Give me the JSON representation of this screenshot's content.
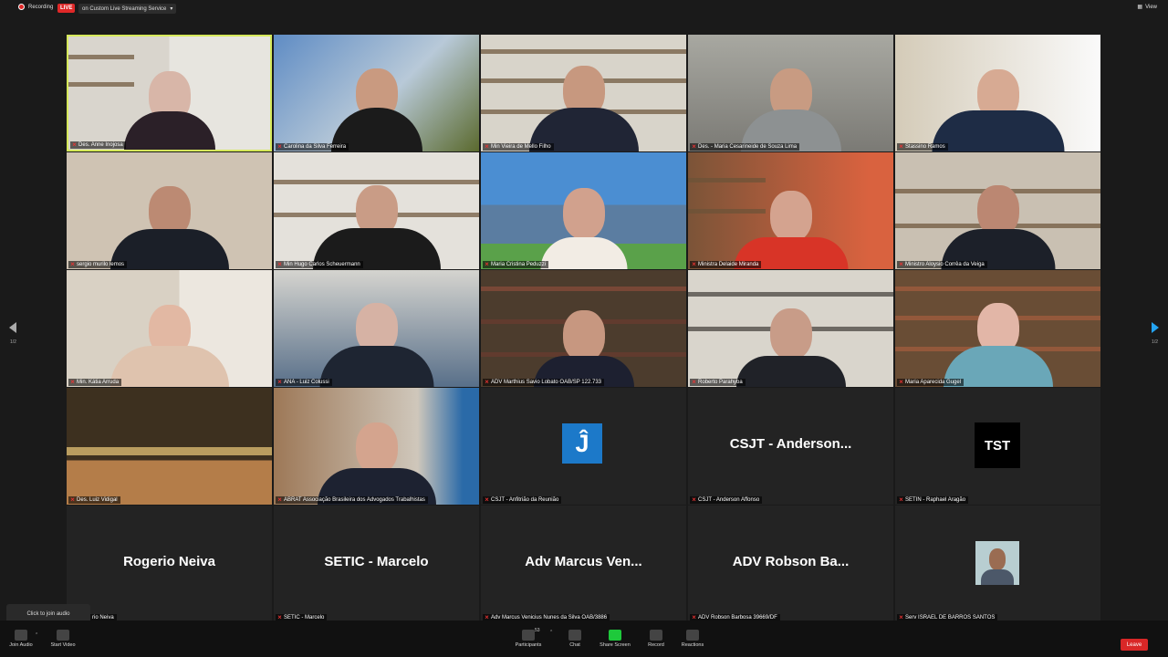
{
  "top": {
    "recording": "Recording",
    "live": "LIVE",
    "stream": "on Custom Live Streaming Service",
    "view": "View"
  },
  "pagination": {
    "left": "1/2",
    "right": "1/2"
  },
  "participants": [
    {
      "name": "Des. Anne Inojosa"
    },
    {
      "name": "Carolina da Silva Ferreira"
    },
    {
      "name": "Min Vieira de Mello Filho"
    },
    {
      "name": "Des. - Maria Cesarineide de Souza Lima"
    },
    {
      "name": "Stassino Ramos"
    },
    {
      "name": "sergio murilo lemos"
    },
    {
      "name": "Min Hugo Carlos Scheuermann"
    },
    {
      "name": "Maria Cristina Peduzzi"
    },
    {
      "name": "Ministra Delaide Miranda"
    },
    {
      "name": "Ministro Aloysio Corrêa da Veiga"
    },
    {
      "name": "Min. Kátia Arruda"
    },
    {
      "name": "ANA - Luiz Colussi"
    },
    {
      "name": "ADV Marthius Savio Lobato OAB/SP 122.733"
    },
    {
      "name": "Roberto Parahyba"
    },
    {
      "name": "Maria Aparecida Gugel"
    },
    {
      "name": "Des. Luiz Vidigal"
    },
    {
      "name": "ABRAT Associação Brasileira dos Advogados Trabalhistas"
    },
    {
      "name": "CSJT - Anfitrião da Reunião"
    },
    {
      "name": "CSJT - Anderson Affonso",
      "display": "CSJT  - Anderson..."
    },
    {
      "name": "SETIN - Raphael Aragão"
    },
    {
      "name": "rio Neiva",
      "display": "Rogerio Neiva"
    },
    {
      "name": "SETIC - Marcelo",
      "display": "SETIC - Marcelo"
    },
    {
      "name": "Adv Marcus Venicius Nunes da Silva OAB/3886",
      "display": "Adv Marcus Ven..."
    },
    {
      "name": "ADV Robson Barbosa 39669/DF",
      "display": "ADV Robson Ba..."
    },
    {
      "name": "Serv ISRAEL DE BARROS SANTOS"
    }
  ],
  "logos": {
    "j": "Ĵ",
    "tst": "TST"
  },
  "tooltip": "Click to join audio",
  "toolbar": {
    "join_audio": "Join Audio",
    "start_video": "Start Video",
    "participants": "Participants",
    "participant_count": "53",
    "chat": "Chat",
    "share_screen": "Share Screen",
    "record": "Record",
    "reactions": "Reactions",
    "leave": "Leave"
  },
  "colors": {
    "background": "#1a1a1a",
    "active_border": "#d6e95b",
    "live_red": "#e02828",
    "share_green": "#1ec93b",
    "arrow_blue": "#24a4f2",
    "logo_blue": "#1c79c9"
  }
}
